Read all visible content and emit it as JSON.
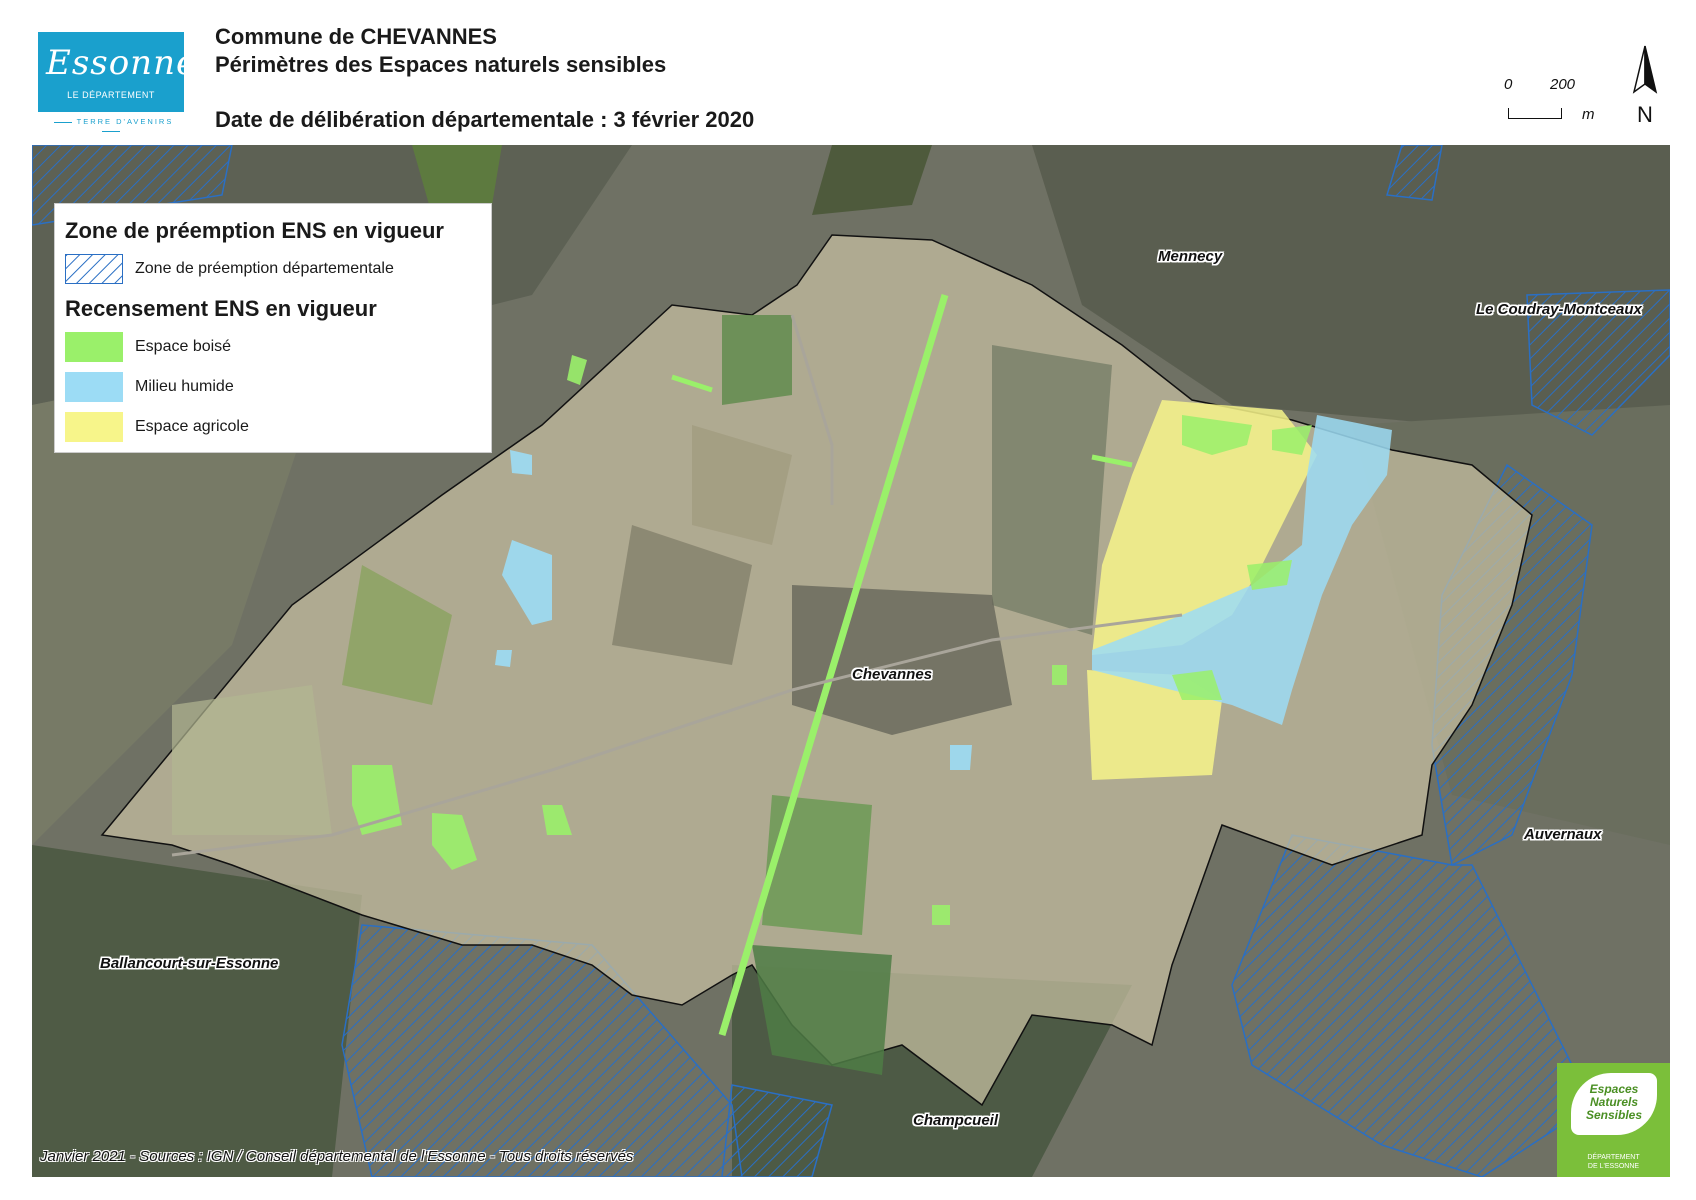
{
  "header": {
    "logo": {
      "script_text": "Essonne",
      "dept_text": "LE DÉPARTEMENT",
      "tagline": "TERRE D'AVENIRS"
    },
    "title_line1": "Commune de CHEVANNES",
    "title_line2": "Périmètres des Espaces naturels sensibles",
    "date_line": "Date de délibération départementale : 3 février 2020"
  },
  "scale_bar": {
    "min_label": "0",
    "max_label": "200",
    "unit": "m"
  },
  "north_arrow": {
    "label": "N",
    "icon": "north-arrow-icon"
  },
  "legend": {
    "heading_preemption": "Zone de préemption ENS en vigueur",
    "items_preemption": [
      {
        "label": "Zone de préemption départementale",
        "pattern": "hatch",
        "color": "#2a6fc4"
      }
    ],
    "heading_recensement": "Recensement ENS en vigueur",
    "items_recensement": [
      {
        "label": "Espace boisé",
        "color": "#9af06a"
      },
      {
        "label": "Milieu humide",
        "color": "#9cdcf5"
      },
      {
        "label": "Espace agricole",
        "color": "#f7f58a"
      }
    ]
  },
  "places": {
    "mennecy": "Mennecy",
    "coudray": "Le Coudray-Montceaux",
    "chevannes": "Chevannes",
    "auvernaux": "Auvernaux",
    "ballancourt": "Ballancourt-sur-Essonne",
    "champcueil": "Champcueil"
  },
  "credits": "Janvier 2021 - Sources : IGN / Conseil départemental de l'Essonne - Tous droits réservés",
  "ens_logo": {
    "line1": "Espaces",
    "line2": "Naturels",
    "line3": "Sensibles",
    "dept1": "DÉPARTEMENT",
    "dept2": "DE L'ESSONNE"
  }
}
